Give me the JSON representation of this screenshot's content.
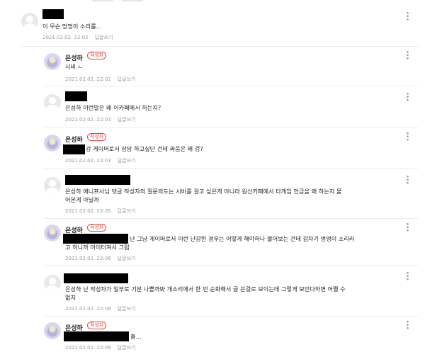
{
  "comments": [
    {
      "nick": "",
      "badge": "",
      "lines": [
        "이 무슨 멍멍이 소리를..."
      ],
      "date": "2021.02.02. 22:02",
      "reply": "답글쓰기"
    },
    {
      "nick": "은성하",
      "badge": "작성자",
      "lines": [
        "시비 ㄴ"
      ],
      "date": "2021.02.02. 22:02",
      "reply": "답글쓰기"
    },
    {
      "nick": "",
      "badge": "",
      "lines": [
        "은성하 이런말은 왜 이카페에서 하는지?"
      ],
      "date": "2021.02.02. 22:03",
      "reply": "답글쓰기"
    },
    {
      "nick": "은성하",
      "badge": "작성자",
      "lines": [
        "강 게이머로서 상담 하고싶단 건데 싸움은 왜 검?"
      ],
      "date": "2021.02.02. 22:03",
      "reply": "답글쓰기"
    },
    {
      "nick": "",
      "badge": "",
      "lines": [
        "은성하 애니프사님 댓글 작성자의 질문의도는 시비를 걸고 싶은게 아니라 원신카페에서 타게임 언급을 왜 하는지 물",
        "어본게 아닐까"
      ],
      "date": "2021.02.02. 22:05",
      "reply": "답글쓰기"
    },
    {
      "nick": "은성하",
      "badge": "작성자",
      "lines": [
        "난 그냥 게이머로서 이런 난감한 경우는 어떻게 해야하나 물어보는 건데 갑자기 멍멍이 소리라",
        "고 하니까 어이터져서 그럼"
      ],
      "date": "2021.02.02. 22:06",
      "reply": "답글쓰기"
    },
    {
      "nick": "",
      "badge": "",
      "lines": [
        "은성하 난 작성자가 일부로 기분 나쁠까봐 개소리에서 한 번 순화해서 글 쓴걸로 보이는데 그렇게 보인다하면 어쩔 수",
        "없지"
      ],
      "date": "2021.02.02. 22:08",
      "reply": "답글쓰기"
    },
    {
      "nick": "은성하",
      "badge": "작성자",
      "lines": [
        "흠..."
      ],
      "date": "2021.02.02. 22:08",
      "reply": "답글쓰기"
    }
  ]
}
